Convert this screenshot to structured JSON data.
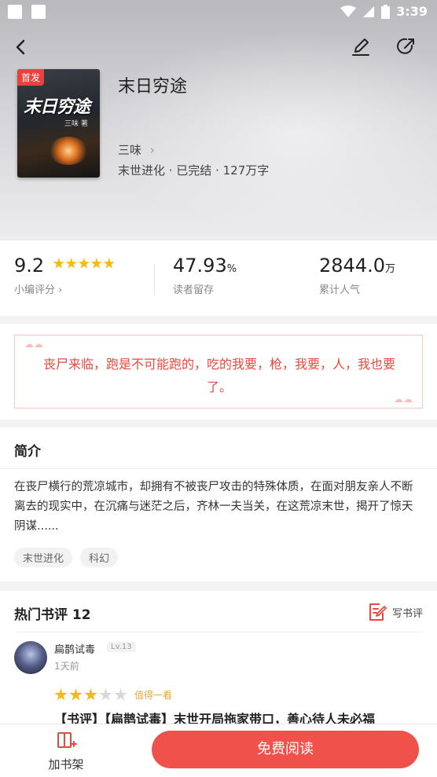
{
  "status_bar": {
    "time": "3:39"
  },
  "book": {
    "badge": "首发",
    "cover_title": "末日穷途",
    "cover_author": "三味 著",
    "title": "末日穷途",
    "author": "三味",
    "author_arrow": "›",
    "meta": "末世进化 · 已完结 · 127万字"
  },
  "stats": {
    "rating": {
      "value": "9.2",
      "stars": 5,
      "label": "小编评分 ›"
    },
    "retention": {
      "value": "47.93",
      "unit": "%",
      "label": "读者留存"
    },
    "popularity": {
      "value": "2844.0",
      "unit": "万",
      "label": "累计人气"
    }
  },
  "quote": {
    "text": "丧尸来临，跑是不可能跑的，吃的我要，枪，我要，人，我也要了。"
  },
  "intro": {
    "title": "简介",
    "text": "在丧尸横行的荒凉城市，却拥有不被丧尸攻击的特殊体质，在面对朋友亲人不断离去的现实中，在沉痛与迷茫之后，齐林一夫当关，在这荒凉末世，揭开了惊天阴谋......",
    "tags": [
      "末世进化",
      "科幻"
    ]
  },
  "reviews": {
    "title": "热门书评 12",
    "write_label": "写书评",
    "items": [
      {
        "name": "扁鹊试毒",
        "level": "Lv.13",
        "time": "1天前",
        "stars": 3,
        "rating_label": "值得一看",
        "title": "【书评】【扁鹊试毒】末世开局拖家带口，善心待人未必福"
      }
    ]
  },
  "bottom_bar": {
    "shelf_label": "加书架",
    "read_label": "免费阅读"
  },
  "colors": {
    "accent": "#f0514b",
    "star": "#f5b914",
    "quote": "#e9493f"
  }
}
